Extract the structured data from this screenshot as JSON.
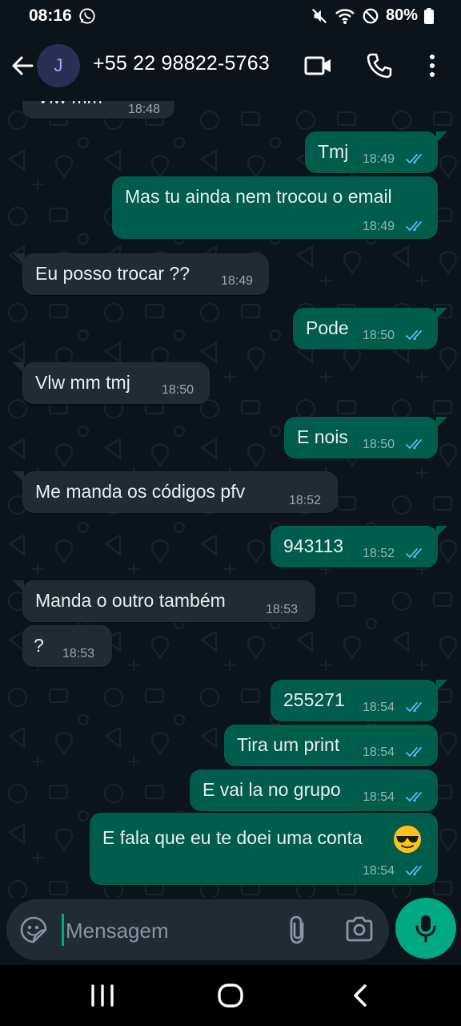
{
  "status_bar": {
    "time": "08:16",
    "battery": "80%"
  },
  "header": {
    "avatar_letter": "J",
    "contact": "+55 22 98822-5763"
  },
  "messages": [
    {
      "dir": "in",
      "text": "Vlw mm",
      "time": "18:48",
      "partial": true
    },
    {
      "dir": "out",
      "text": "Tmj",
      "time": "18:49",
      "read": true
    },
    {
      "dir": "out",
      "text": "Mas tu ainda nem trocou o email",
      "time": "18:49",
      "read": true
    },
    {
      "dir": "in",
      "text": "Eu posso trocar ??",
      "time": "18:49"
    },
    {
      "dir": "out",
      "text": "Pode",
      "time": "18:50",
      "read": true
    },
    {
      "dir": "in",
      "text": "Vlw mm tmj",
      "time": "18:50"
    },
    {
      "dir": "out",
      "text": "E nois",
      "time": "18:50",
      "read": true
    },
    {
      "dir": "in",
      "text": "Me manda os códigos pfv",
      "time": "18:52"
    },
    {
      "dir": "out",
      "text": "943113",
      "time": "18:52",
      "read": true
    },
    {
      "dir": "in",
      "text": "Manda o outro também",
      "time": "18:53"
    },
    {
      "dir": "in",
      "text": "?",
      "time": "18:53"
    },
    {
      "dir": "out",
      "text": "255271",
      "time": "18:54",
      "read": true
    },
    {
      "dir": "out",
      "text": "Tira um print",
      "time": "18:54",
      "read": true
    },
    {
      "dir": "out",
      "text": "E vai la no grupo",
      "time": "18:54",
      "read": true
    },
    {
      "dir": "out",
      "text": "E fala que eu te doei uma conta",
      "emoji": "😎",
      "time": "18:54",
      "read": true
    }
  ],
  "input": {
    "placeholder": "Mensagem"
  },
  "colors": {
    "background": "#0b141a",
    "incoming_bubble": "#202c33",
    "outgoing_bubble": "#005c4b",
    "read_ticks": "#53bdeb",
    "accent": "#00a884"
  },
  "icons": {
    "header": [
      "back-arrow-icon",
      "video-call-icon",
      "voice-call-icon",
      "more-options-icon"
    ],
    "input": [
      "sticker-icon",
      "attach-icon",
      "camera-icon",
      "mic-icon"
    ],
    "nav": [
      "recent-apps-icon",
      "home-icon",
      "nav-back-icon"
    ]
  }
}
